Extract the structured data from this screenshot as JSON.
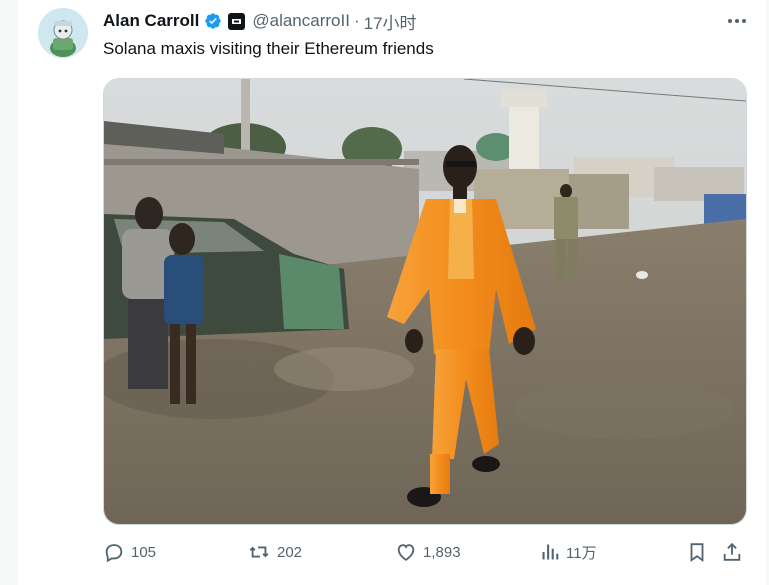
{
  "tweet": {
    "author_name": "Alan Carroll",
    "handle": "@alancarroII",
    "separator": "·",
    "time": "17小时",
    "text": "Solana maxis visiting their Ethereum friends"
  },
  "metrics": {
    "replies": "105",
    "retweets": "202",
    "likes": "1,893",
    "views": "11万"
  },
  "icons": {
    "verified": "verified-badge-icon",
    "affiliation": "affiliation-badge-icon",
    "more": "more-dots-icon",
    "reply": "reply-icon",
    "retweet": "retweet-icon",
    "like": "heart-icon",
    "views": "views-bar-chart-icon",
    "bookmark": "bookmark-icon",
    "share": "share-icon"
  },
  "colors": {
    "text_primary": "#0f1419",
    "text_secondary": "#536471",
    "verified_blue": "#1d9bf0",
    "suit_orange": "#f28c1b"
  }
}
